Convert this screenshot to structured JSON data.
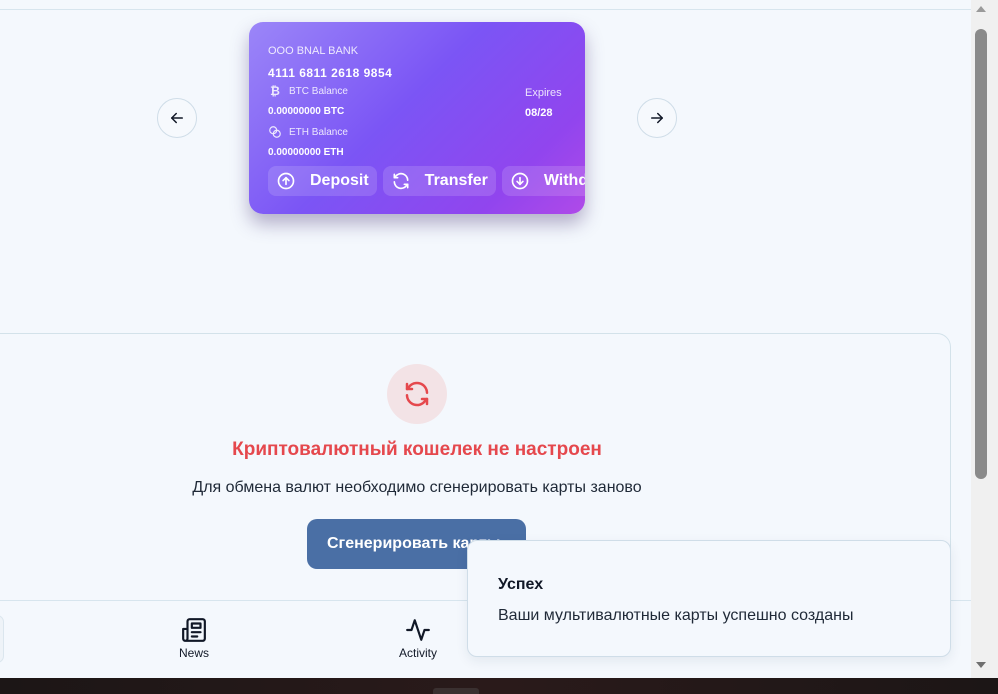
{
  "card": {
    "bank_name": "OOO BNAL BANK",
    "number": "4111 6811 2618 9854",
    "btc_label": "BTC Balance",
    "btc_value": "0.00000000 BTC",
    "eth_label": "ETH Balance",
    "eth_value": "0.00000000 ETH",
    "expires_label": "Expires",
    "expires_value": "08/28",
    "btc_icon": "₿",
    "actions": {
      "deposit": "Deposit",
      "transfer": "Transfer",
      "withdraw": "Withd"
    },
    "gradient_colors": [
      "#9b86f8",
      "#7b55f5",
      "#9145ee",
      "#b04ae8"
    ]
  },
  "wallet_error": {
    "title": "Криптовалютный кошелек не настроен",
    "message": "Для обмена валют необходимо сгенерировать карты заново",
    "button_label": "Сгенерировать карты",
    "title_color": "#e5484d",
    "button_color": "#4a6fa5",
    "icon": "refresh-icon"
  },
  "bottom_nav": {
    "items": [
      {
        "label": "News",
        "icon": "newspaper-icon"
      },
      {
        "label": "Activity",
        "icon": "activity-icon"
      }
    ]
  },
  "toast": {
    "title": "Успех",
    "message": "Ваши мультивалютные карты успешно созданы"
  }
}
